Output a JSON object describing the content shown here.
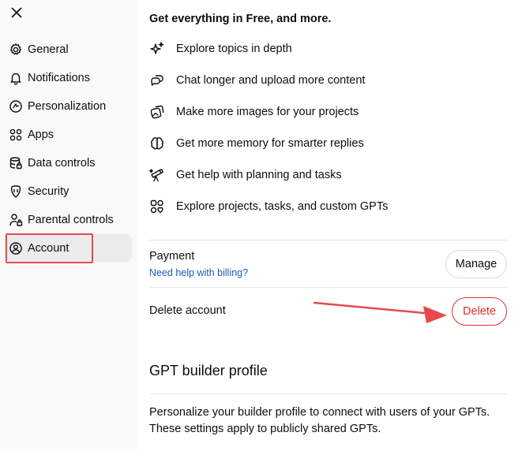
{
  "close": {
    "icon": "close-icon"
  },
  "sidebar": {
    "items": [
      {
        "label": "General",
        "icon": "gear-icon"
      },
      {
        "label": "Notifications",
        "icon": "bell-icon"
      },
      {
        "label": "Personalization",
        "icon": "personalization-icon"
      },
      {
        "label": "Apps",
        "icon": "apps-grid-icon"
      },
      {
        "label": "Data controls",
        "icon": "database-icon"
      },
      {
        "label": "Security",
        "icon": "shield-icon"
      },
      {
        "label": "Parental controls",
        "icon": "parental-icon"
      },
      {
        "label": "Account",
        "icon": "account-icon",
        "active": true
      }
    ]
  },
  "upsell": {
    "heading": "Get everything in Free, and more.",
    "features": [
      {
        "label": "Explore topics in depth",
        "icon": "sparkle-icon"
      },
      {
        "label": "Chat longer and upload more content",
        "icon": "chat-bubbles-icon"
      },
      {
        "label": "Make more images for your projects",
        "icon": "images-icon"
      },
      {
        "label": "Get more memory for smarter replies",
        "icon": "brain-icon"
      },
      {
        "label": "Get help with planning and tasks",
        "icon": "telescope-icon"
      },
      {
        "label": "Explore projects, tasks, and custom GPTs",
        "icon": "shapes-icon"
      }
    ]
  },
  "payment": {
    "label": "Payment",
    "billing_link": "Need help with billing?",
    "manage_label": "Manage"
  },
  "delete_account": {
    "label": "Delete account",
    "button_label": "Delete"
  },
  "gpt_builder": {
    "title": "GPT builder profile",
    "description": "Personalize your builder profile to connect with users of your GPTs. These settings apply to publicly shared GPTs."
  },
  "colors": {
    "sidebar_bg": "#f9f9f9",
    "active_item_bg": "#ececec",
    "link": "#1a5bb5",
    "danger": "#e02e2a",
    "annotation": "#e8494f"
  }
}
